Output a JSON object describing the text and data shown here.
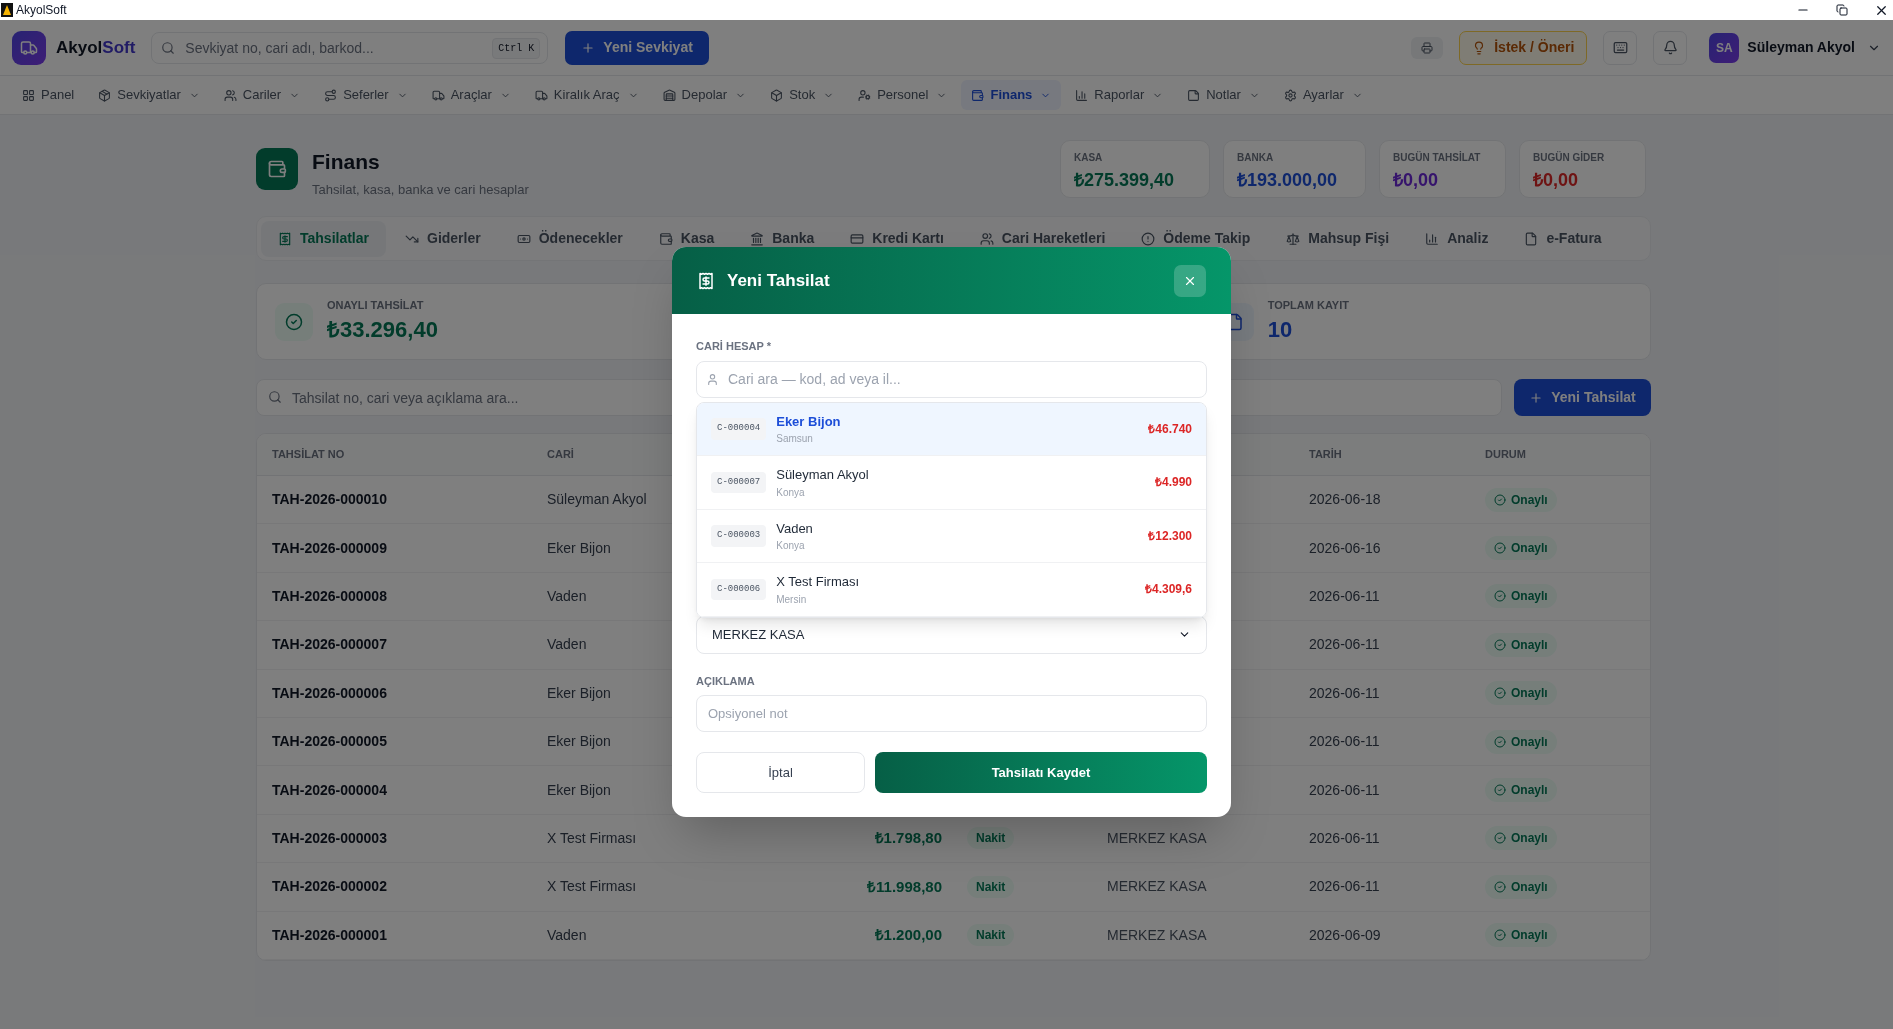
{
  "window": {
    "title": "AkyolSoft"
  },
  "topbar": {
    "brand": {
      "name": "Akyol",
      "accent": "Soft"
    },
    "search": {
      "placeholder": "Sevkiyat no, cari adı, barkod...",
      "shortcut": "Ctrl K"
    },
    "new_button": "Yeni Sevkiyat",
    "feedback_button": "İstek / Öneri",
    "user": {
      "initials": "SA",
      "name": "Süleyman Akyol"
    }
  },
  "nav": [
    {
      "label": "Panel",
      "selected": false,
      "dropdown": false
    },
    {
      "label": "Sevkiyatlar",
      "selected": false,
      "dropdown": true
    },
    {
      "label": "Cariler",
      "selected": false,
      "dropdown": true
    },
    {
      "label": "Seferler",
      "selected": false,
      "dropdown": true
    },
    {
      "label": "Araçlar",
      "selected": false,
      "dropdown": true
    },
    {
      "label": "Kiralık Araç",
      "selected": false,
      "dropdown": true
    },
    {
      "label": "Depolar",
      "selected": false,
      "dropdown": true
    },
    {
      "label": "Stok",
      "selected": false,
      "dropdown": true
    },
    {
      "label": "Personel",
      "selected": false,
      "dropdown": true
    },
    {
      "label": "Finans",
      "selected": true,
      "dropdown": true
    },
    {
      "label": "Raporlar",
      "selected": false,
      "dropdown": true
    },
    {
      "label": "Notlar",
      "selected": false,
      "dropdown": true
    },
    {
      "label": "Ayarlar",
      "selected": false,
      "dropdown": true
    }
  ],
  "page": {
    "title": "Finans",
    "subtitle": "Tahsilat, kasa, banka ve cari hesaplar"
  },
  "balances": [
    {
      "label": "KASA",
      "value": "₺275.399,40"
    },
    {
      "label": "BANKA",
      "value": "₺193.000,00"
    },
    {
      "label": "BUGÜN TAHSİLAT",
      "value": "₺0,00"
    },
    {
      "label": "BUGÜN GİDER",
      "value": "₺0,00"
    }
  ],
  "tabs": [
    {
      "label": "Tahsilatlar",
      "selected": true
    },
    {
      "label": "Giderler",
      "selected": false
    },
    {
      "label": "Ödenecekler",
      "selected": false
    },
    {
      "label": "Kasa",
      "selected": false
    },
    {
      "label": "Banka",
      "selected": false
    },
    {
      "label": "Kredi Kartı",
      "selected": false
    },
    {
      "label": "Cari Hareketleri",
      "selected": false
    },
    {
      "label": "Ödeme Takip",
      "selected": false
    },
    {
      "label": "Mahsup Fişi",
      "selected": false
    },
    {
      "label": "Analiz",
      "selected": false
    },
    {
      "label": "e-Fatura",
      "selected": false
    }
  ],
  "summary": [
    {
      "label": "ONAYLI TAHSİLAT",
      "value": "₺33.296,40"
    },
    {
      "label": "TOPLAM KAYIT",
      "value": "10"
    }
  ],
  "search": {
    "placeholder": "Tahsilat no, cari veya açıklama ara..."
  },
  "new_button": "Yeni Tahsilat",
  "table": {
    "columns": [
      "TAHSİLAT NO",
      "CARİ",
      "TARİH",
      "DURUM"
    ],
    "rows": [
      {
        "no": "TAH-2026-000010",
        "cari": "Süleyman Akyol",
        "date": "2026-06-18",
        "status": "Onaylı"
      },
      {
        "no": "TAH-2026-000009",
        "cari": "Eker Bijon",
        "date": "2026-06-16",
        "status": "Onaylı"
      },
      {
        "no": "TAH-2026-000008",
        "cari": "Vaden",
        "date": "2026-06-11",
        "status": "Onaylı"
      },
      {
        "no": "TAH-2026-000007",
        "cari": "Vaden",
        "date": "2026-06-11",
        "status": "Onaylı"
      },
      {
        "no": "TAH-2026-000006",
        "cari": "Eker Bijon",
        "date": "2026-06-11",
        "status": "Onaylı"
      },
      {
        "no": "TAH-2026-000005",
        "cari": "Eker Bijon",
        "date": "2026-06-11",
        "status": "Onaylı"
      },
      {
        "no": "TAH-2026-000004",
        "cari": "Eker Bijon",
        "date": "2026-06-11",
        "status": "Onaylı"
      },
      {
        "no": "TAH-2026-000003",
        "cari": "X Test Firması",
        "amount": "₺1.798,80",
        "method": "Nakit",
        "account": "MERKEZ KASA",
        "date": "2026-06-11",
        "status": "Onaylı"
      },
      {
        "no": "TAH-2026-000002",
        "cari": "X Test Firması",
        "amount": "₺11.998,80",
        "method": "Nakit",
        "account": "MERKEZ KASA",
        "date": "2026-06-11",
        "status": "Onaylı"
      },
      {
        "no": "TAH-2026-000001",
        "cari": "Vaden",
        "amount": "₺1.200,00",
        "method": "Nakit",
        "account": "MERKEZ KASA",
        "date": "2026-06-09",
        "status": "Onaylı"
      }
    ]
  },
  "modal": {
    "title": "Yeni Tahsilat",
    "account_label": "CARİ HESAP *",
    "account_search": {
      "placeholder": "Cari ara — kod, ad veya il..."
    },
    "results": [
      {
        "code": "C-000004",
        "name": "Eker Bijon",
        "city": "Samsun",
        "balance": "₺46.740",
        "selected": true
      },
      {
        "code": "C-000007",
        "name": "Süleyman Akyol",
        "city": "Konya",
        "balance": "₺4.990",
        "selected": false
      },
      {
        "code": "C-000003",
        "name": "Vaden",
        "city": "Konya",
        "balance": "₺12.300",
        "selected": false
      },
      {
        "code": "C-000006",
        "name": "X Test Firması",
        "city": "Mersin",
        "balance": "₺4.309,6",
        "selected": false
      }
    ],
    "cash_account": "MERKEZ KASA",
    "note_label": "AÇIKLAMA",
    "note": {
      "placeholder": "Opsiyonel not"
    },
    "cancel": "İptal",
    "submit": "Tahsilatı Kaydet"
  }
}
